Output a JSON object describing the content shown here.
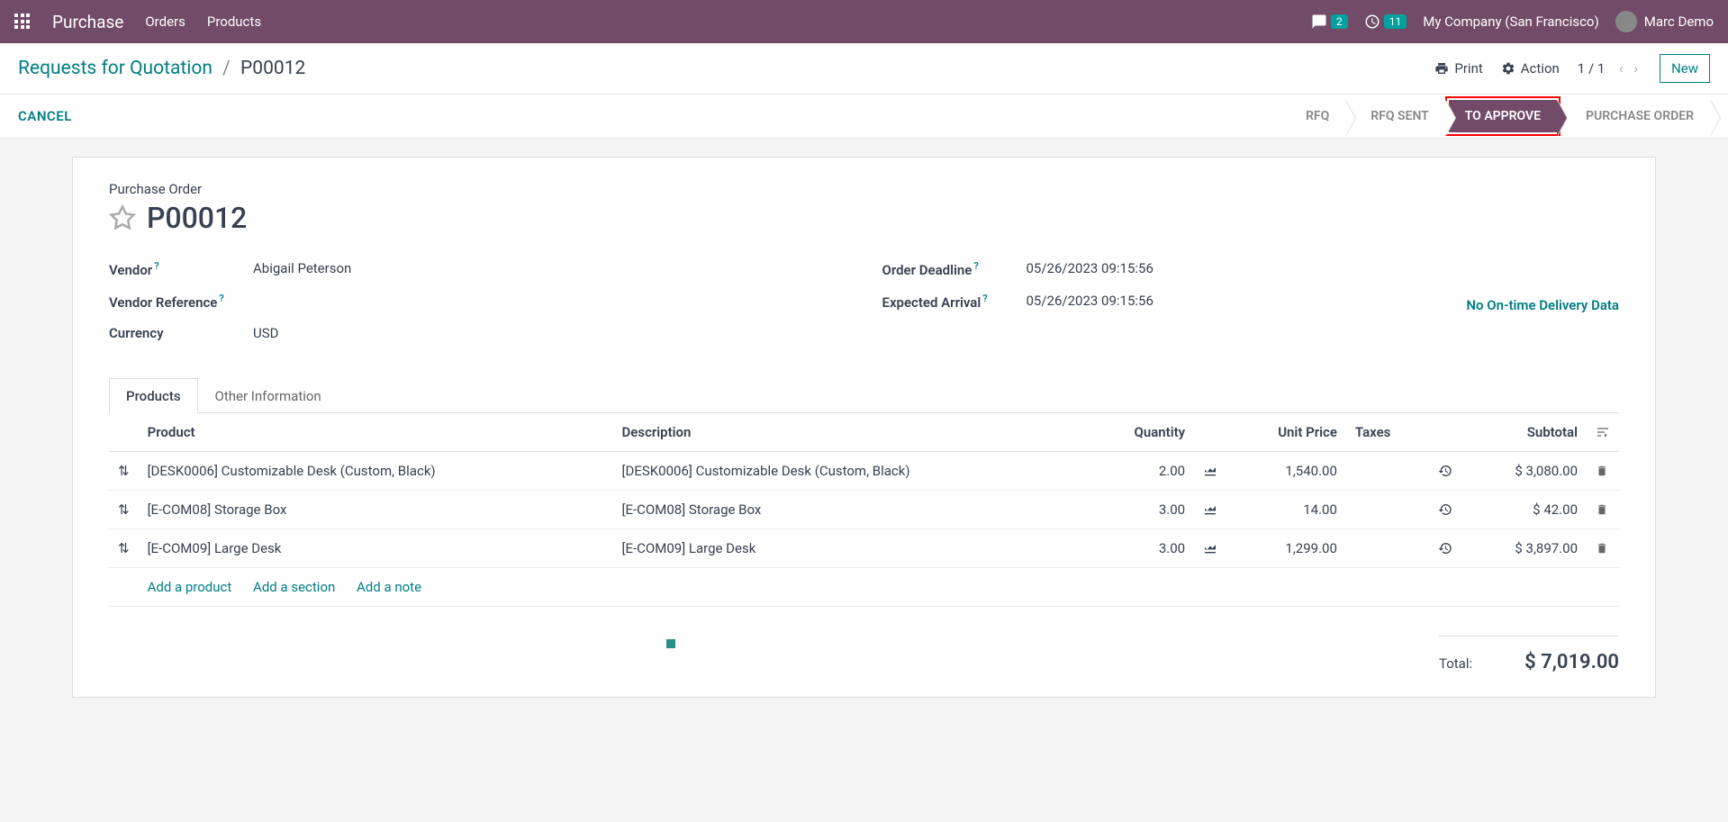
{
  "topbar": {
    "app_title": "Purchase",
    "nav": {
      "orders": "Orders",
      "products": "Products"
    },
    "messages_badge": "2",
    "activities_badge": "11",
    "company": "My Company (San Francisco)",
    "user": "Marc Demo"
  },
  "controlbar": {
    "breadcrumb_root": "Requests for Quotation",
    "breadcrumb_current": "P00012",
    "print_label": "Print",
    "action_label": "Action",
    "pager": "1 / 1",
    "new_label": "New"
  },
  "statusbar": {
    "cancel": "CANCEL",
    "steps": {
      "rfq": "RFQ",
      "rfq_sent": "RFQ SENT",
      "to_approve": "TO APPROVE",
      "purchase_order": "PURCHASE ORDER"
    }
  },
  "form": {
    "type_label": "Purchase Order",
    "name": "P00012",
    "labels": {
      "vendor": "Vendor",
      "vendor_ref": "Vendor Reference",
      "currency": "Currency",
      "order_deadline": "Order Deadline",
      "expected_arrival": "Expected Arrival"
    },
    "values": {
      "vendor": "Abigail Peterson",
      "vendor_ref": "",
      "currency": "USD",
      "order_deadline": "05/26/2023 09:15:56",
      "expected_arrival": "05/26/2023 09:15:56"
    },
    "delivery_link": "No On-time Delivery Data"
  },
  "tabs": {
    "products": "Products",
    "other": "Other Information"
  },
  "table": {
    "headers": {
      "product": "Product",
      "description": "Description",
      "quantity": "Quantity",
      "unit_price": "Unit Price",
      "taxes": "Taxes",
      "subtotal": "Subtotal"
    },
    "rows": [
      {
        "product": "[DESK0006] Customizable Desk (Custom, Black)",
        "description": "[DESK0006] Customizable Desk (Custom, Black)",
        "quantity": "2.00",
        "unit_price": "1,540.00",
        "subtotal": "$ 3,080.00"
      },
      {
        "product": "[E-COM08] Storage Box",
        "description": "[E-COM08] Storage Box",
        "quantity": "3.00",
        "unit_price": "14.00",
        "subtotal": "$ 42.00"
      },
      {
        "product": "[E-COM09] Large Desk",
        "description": "[E-COM09] Large Desk",
        "quantity": "3.00",
        "unit_price": "1,299.00",
        "subtotal": "$ 3,897.00"
      }
    ],
    "add_links": {
      "product": "Add a product",
      "section": "Add a section",
      "note": "Add a note"
    },
    "total_label": "Total:",
    "total_value": "$ 7,019.00"
  }
}
